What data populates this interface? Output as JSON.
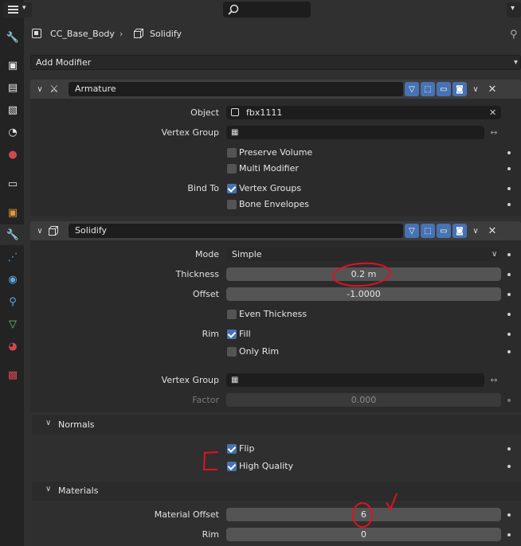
{
  "topbar": {
    "editor_type_icon": "properties-editor-icon",
    "search_icon": "search-icon",
    "pin_icon": "pin-icon"
  },
  "breadcrumb": {
    "object_name": "CC_Base_Body",
    "modifier_name": "Solidify"
  },
  "add_modifier_label": "Add Modifier",
  "sidebar_tabs": [
    "tool-icon",
    "render-icon",
    "output-icon",
    "view-layer-icon",
    "scene-icon",
    "world-icon",
    "collection-icon",
    "object-icon",
    "modifier-icon",
    "particles-icon",
    "physics-icon",
    "constraints-icon",
    "data-icon",
    "material-icon",
    "texture-icon"
  ],
  "armature": {
    "name": "Armature",
    "object_label": "Object",
    "object_value": "fbx1111",
    "vertex_group_label": "Vertex Group",
    "preserve_volume_label": "Preserve Volume",
    "preserve_volume": false,
    "multi_modifier_label": "Multi Modifier",
    "multi_modifier": false,
    "bind_to_label": "Bind To",
    "vertex_groups_label": "Vertex Groups",
    "vertex_groups": true,
    "bone_envelopes_label": "Bone Envelopes",
    "bone_envelopes": false
  },
  "solidify": {
    "name": "Solidify",
    "mode_label": "Mode",
    "mode_value": "Simple",
    "thickness_label": "Thickness",
    "thickness_value": "0.2 m",
    "offset_label": "Offset",
    "offset_value": "-1.0000",
    "even_thickness_label": "Even Thickness",
    "even_thickness": false,
    "rim_label": "Rim",
    "fill_label": "Fill",
    "fill": true,
    "only_rim_label": "Only Rim",
    "only_rim": false,
    "vertex_group_label": "Vertex Group",
    "factor_label": "Factor",
    "factor_value": "0.000",
    "normals_label": "Normals",
    "flip_label": "Flip",
    "flip": true,
    "high_quality_label": "High Quality",
    "high_quality": true,
    "materials_label": "Materials",
    "material_offset_label": "Material Offset",
    "material_offset_value": "6",
    "rim_material_label": "Rim",
    "rim_material_value": "0"
  },
  "colors": {
    "accent": "#4772b3",
    "annotation": "#e0121e",
    "background": "#303030"
  }
}
